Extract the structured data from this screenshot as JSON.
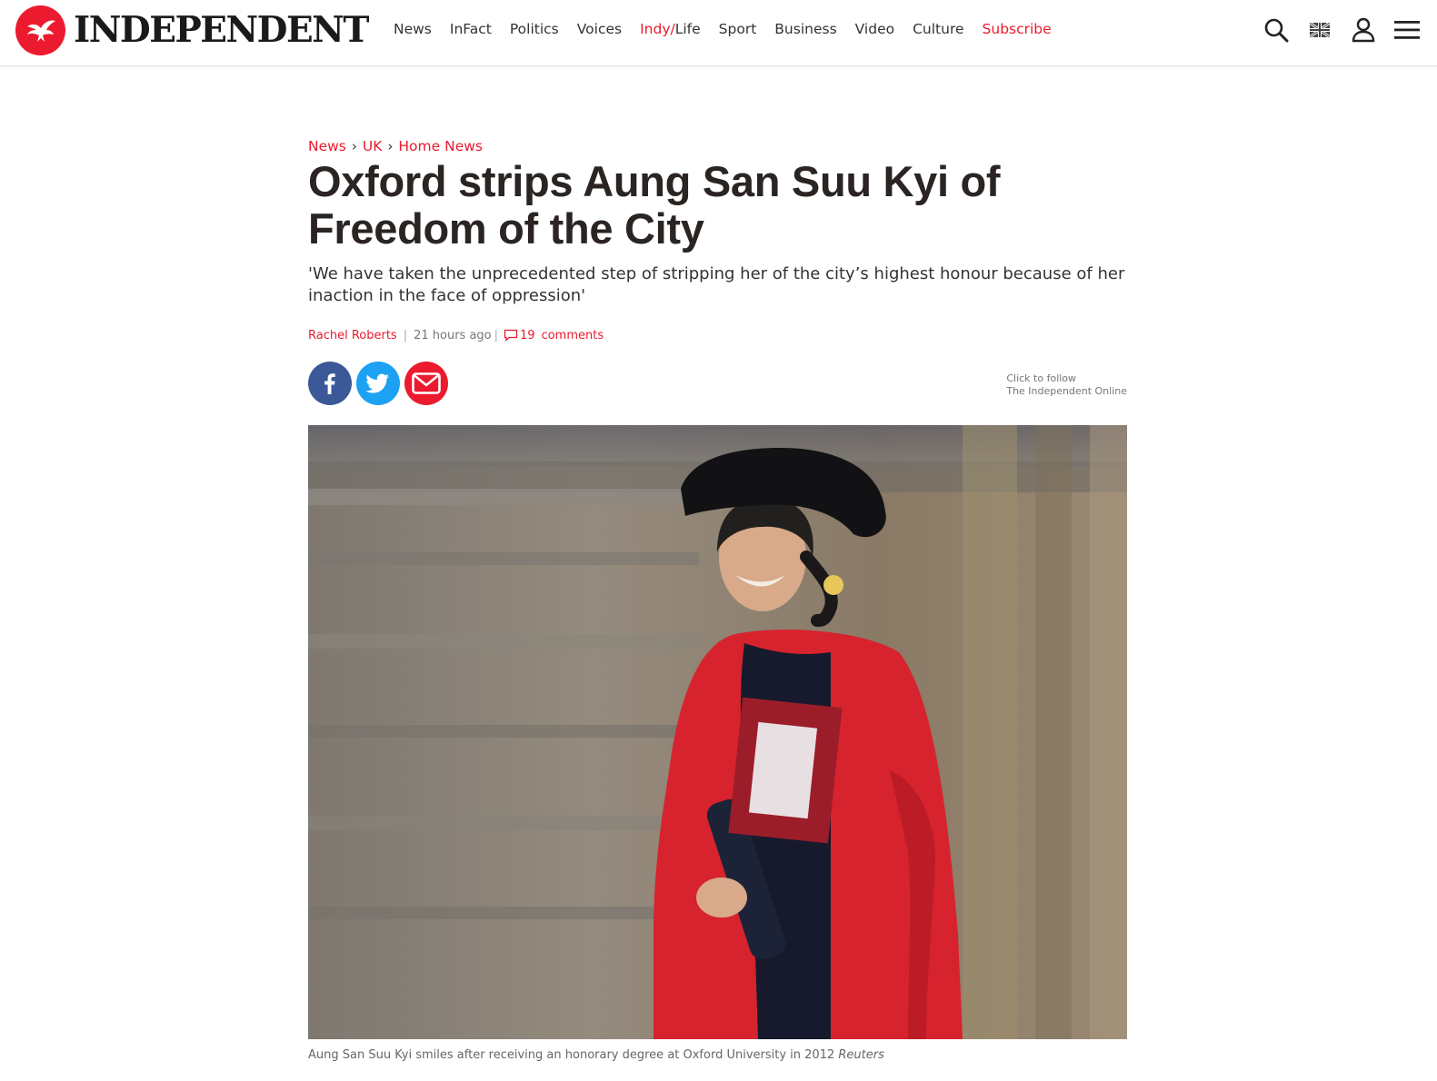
{
  "brand": {
    "name": "INDEPENDENT",
    "accent": "#ec1a2e"
  },
  "nav": {
    "items": [
      "News",
      "InFact",
      "Politics",
      "Voices"
    ],
    "indy_prefix": "Indy/",
    "indy_suffix": "Life",
    "items_after": [
      "Sport",
      "Business",
      "Video",
      "Culture"
    ],
    "subscribe": "Subscribe"
  },
  "header_icons": [
    "search-icon",
    "uk-flag-icon",
    "user-icon",
    "menu-icon"
  ],
  "article": {
    "breadcrumb": [
      "News",
      "UK",
      "Home News"
    ],
    "breadcrumb_separator": "›",
    "headline": "Oxford strips Aung San Suu Kyi of Freedom of the City",
    "standfirst": "'We have taken the unprecedented step of stripping her of the city’s highest honour because of her inaction in the face of oppression'",
    "author": "Rachel Roberts",
    "time": "21 hours ago",
    "comments_count": "19",
    "comments_label": "comments",
    "share_icons": [
      "facebook-icon",
      "twitter-icon",
      "email-icon"
    ],
    "follow_line1": "Click to follow",
    "follow_line2": "The Independent Online",
    "caption_text": "Aung San Suu Kyi smiles after receiving an honorary degree at Oxford University in 2012",
    "caption_credit": "Reuters"
  }
}
